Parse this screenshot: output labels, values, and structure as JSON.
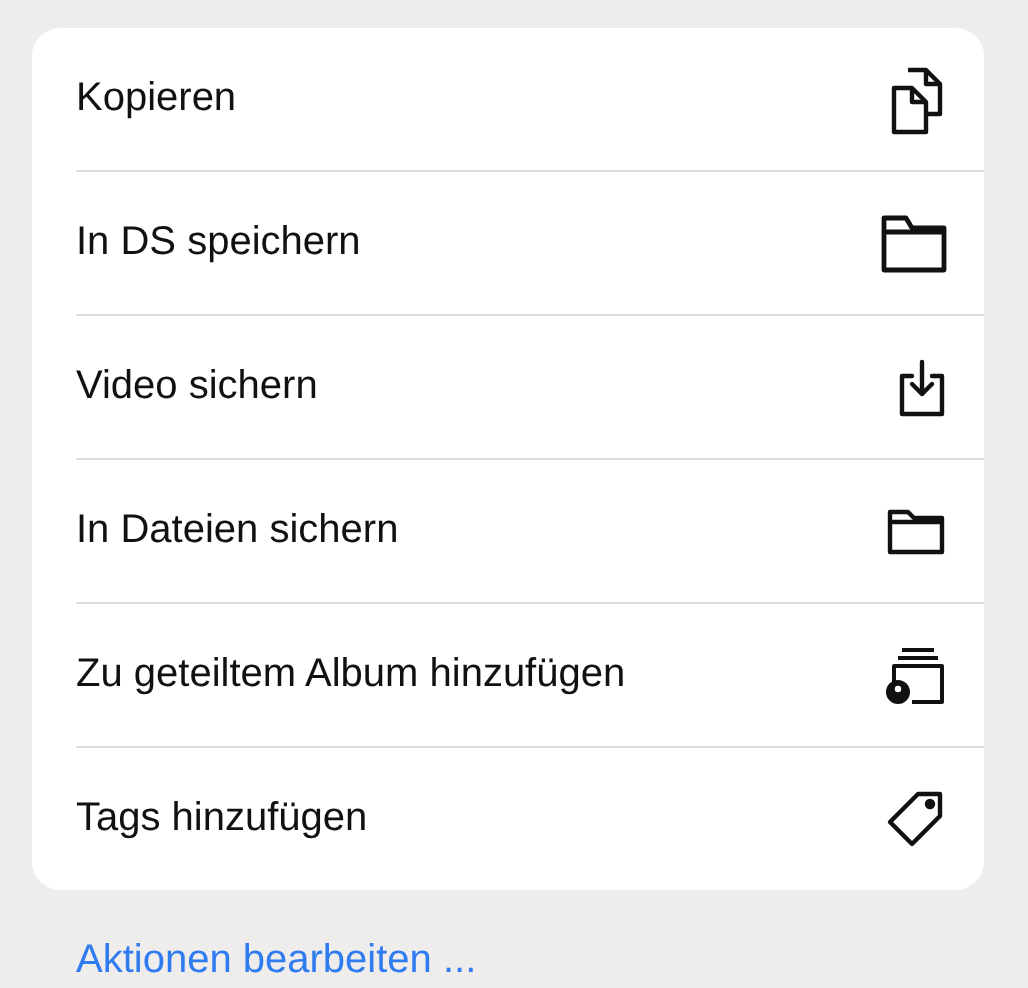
{
  "actions": [
    {
      "label": "Kopieren",
      "kind": "copy"
    },
    {
      "label": "In DS speichern",
      "kind": "folder-large"
    },
    {
      "label": "Video sichern",
      "kind": "download"
    },
    {
      "label": "In Dateien sichern",
      "kind": "folder"
    },
    {
      "label": "Zu geteiltem Album hinzufügen",
      "kind": "shared-album"
    },
    {
      "label": "Tags hinzufügen",
      "kind": "tag"
    }
  ],
  "edit_link": "Aktionen bearbeiten ..."
}
